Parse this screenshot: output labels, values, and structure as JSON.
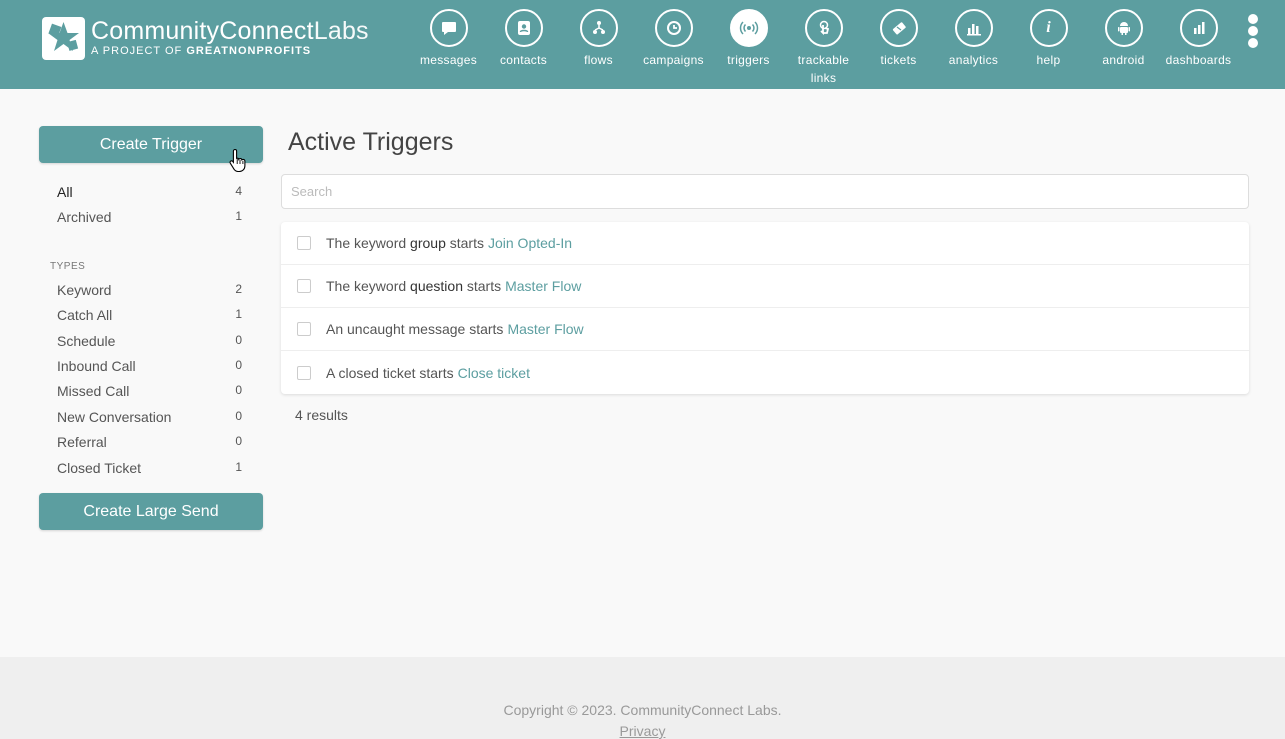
{
  "header": {
    "brand_main": "CommunityConnect",
    "brand_labs": "Labs",
    "brand_sub_prefix": "A PROJECT OF",
    "brand_sub_org": "GREATNONPROFITS",
    "nav": [
      {
        "label": "messages",
        "icon": "chat-bubble-icon"
      },
      {
        "label": "contacts",
        "icon": "contact-card-icon"
      },
      {
        "label": "flows",
        "icon": "flow-tree-icon"
      },
      {
        "label": "campaigns",
        "icon": "campaign-clock-icon"
      },
      {
        "label": "triggers",
        "icon": "broadcast-icon",
        "active": true
      },
      {
        "label": "trackable",
        "label2": "links",
        "icon": "touch-link-icon"
      },
      {
        "label": "tickets",
        "icon": "ticket-icon"
      },
      {
        "label": "analytics",
        "icon": "bar-chart-icon"
      },
      {
        "label": "help",
        "icon": "info-icon"
      },
      {
        "label": "android",
        "icon": "android-icon"
      },
      {
        "label": "dashboards",
        "icon": "dashboard-chart-icon"
      }
    ]
  },
  "sidebar": {
    "create_trigger": "Create Trigger",
    "filters": [
      {
        "label": "All",
        "count": "4"
      },
      {
        "label": "Archived",
        "count": "1"
      }
    ],
    "types_heading": "TYPES",
    "types": [
      {
        "label": "Keyword",
        "count": "2"
      },
      {
        "label": "Catch All",
        "count": "1"
      },
      {
        "label": "Schedule",
        "count": "0"
      },
      {
        "label": "Inbound Call",
        "count": "0"
      },
      {
        "label": "Missed Call",
        "count": "0"
      },
      {
        "label": "New Conversation",
        "count": "0"
      },
      {
        "label": "Referral",
        "count": "0"
      },
      {
        "label": "Closed Ticket",
        "count": "1"
      }
    ],
    "create_large_send": "Create Large Send"
  },
  "main": {
    "title": "Active Triggers",
    "search_placeholder": "Search",
    "triggers": [
      {
        "prefix": "The keyword ",
        "keyword": "group",
        "suffix": " starts",
        "target": "Join Opted-In"
      },
      {
        "prefix": "The keyword ",
        "keyword": "question",
        "suffix": " starts",
        "target": "Master Flow"
      },
      {
        "prefix": "An uncaught message starts",
        "keyword": "",
        "suffix": "",
        "target": "Master Flow"
      },
      {
        "prefix": "A closed ticket starts",
        "keyword": "",
        "suffix": "",
        "target": "Close ticket"
      }
    ],
    "results": "4 results"
  },
  "footer": {
    "copyright": "Copyright © 2023. CommunityConnect Labs.",
    "privacy": "Privacy"
  },
  "colors": {
    "accent": "#5c9ea0",
    "footer_bg": "#efefef",
    "page_bg": "#f9f9f9"
  }
}
